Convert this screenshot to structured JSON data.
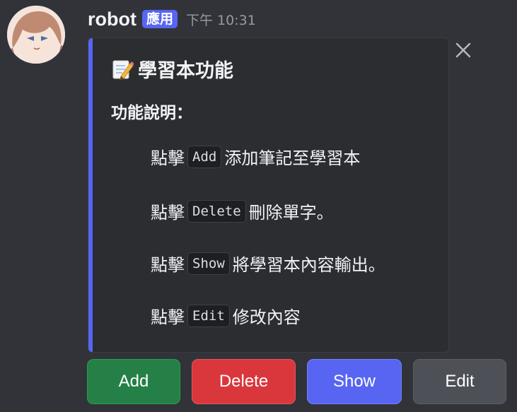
{
  "message": {
    "username": "robot",
    "badge": "應用",
    "timestamp": "下午 10:31",
    "avatar_icon": "anime-character-avatar"
  },
  "dismiss": {
    "icon": "close-icon"
  },
  "embed": {
    "accent_color": "#5865f2",
    "title_icon": "memo-icon",
    "title": "學習本功能",
    "section_heading": "功能說明：",
    "lines": [
      {
        "prefix": "點擊",
        "code": "Add",
        "suffix": "添加筆記至學習本"
      },
      {
        "prefix": "點擊",
        "code": "Delete",
        "suffix": "刪除單字。"
      },
      {
        "prefix": "點擊",
        "code": "Show",
        "suffix": "將學習本內容輸出。"
      },
      {
        "prefix": "點擊",
        "code": "Edit",
        "suffix": "修改內容"
      }
    ]
  },
  "buttons": [
    {
      "label": "Add",
      "color": "#248046"
    },
    {
      "label": "Delete",
      "color": "#da373c"
    },
    {
      "label": "Show",
      "color": "#5865f2"
    },
    {
      "label": "Edit",
      "color": "#4e5058"
    }
  ]
}
